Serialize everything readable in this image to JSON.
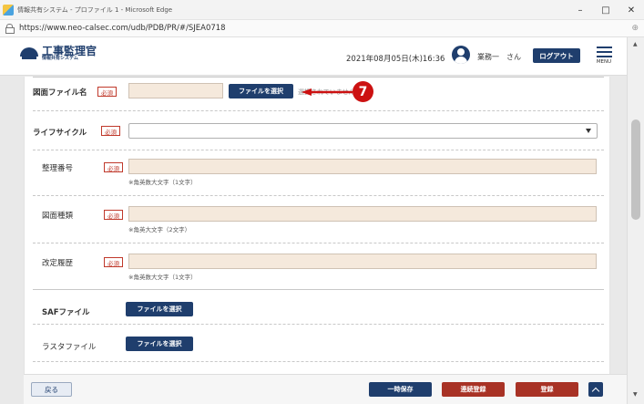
{
  "window": {
    "title": "情報共有システム - プロファイル 1 - Microsoft Edge",
    "minimize": "–",
    "maximize": "□",
    "close": "✕"
  },
  "browser": {
    "url": "https://www.neo-calsec.com/udb/PDB/PR/#/SJEA0718"
  },
  "header": {
    "logo_main": "工事監理官",
    "logo_sub": "情報共有システム",
    "datetime": "2021年08月05日(木)16:36",
    "user": "業務一　さん",
    "logout": "ログアウト",
    "menu": "MENU"
  },
  "form": {
    "required": "必須",
    "drawing_file": {
      "label": "図面ファイル名",
      "button": "ファイルを選択",
      "partial": "選択されていません"
    },
    "lifecycle": {
      "label": "ライフサイクル"
    },
    "ref_number": {
      "label": "整理番号",
      "hint": "※角英数大文字（1文字）"
    },
    "drawing_type": {
      "label": "図面種類",
      "hint": "※角英大文字（2文字）"
    },
    "revision": {
      "label": "改定履歴",
      "hint": "※角英数大文字（1文字）"
    },
    "saf_file": {
      "label": "SAFファイル",
      "button": "ファイルを選択"
    },
    "raster_file": {
      "label": "ラスタファイル",
      "button": "ファイルを選択"
    }
  },
  "annotation": {
    "number": "7",
    "color": "#cc1111"
  },
  "footer": {
    "back": "戻る",
    "temp_save": "一時保存",
    "continuous_register": "連続登録",
    "register": "登録"
  },
  "colors": {
    "navy": "#1f3e6d",
    "red": "#a83225",
    "input_bg": "#f5e9dc"
  }
}
